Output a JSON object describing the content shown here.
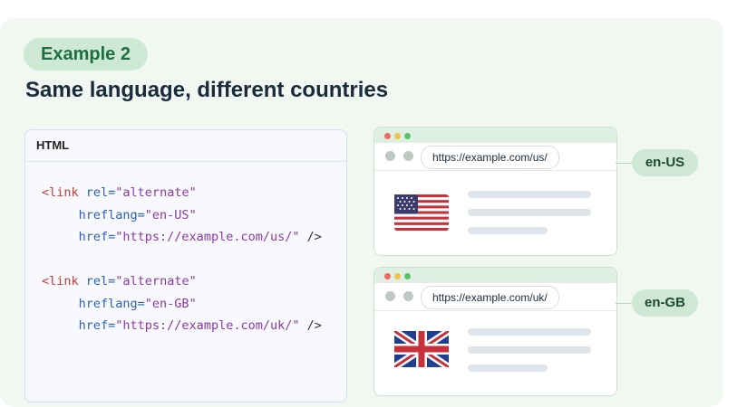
{
  "example_label": "Example 2",
  "title": "Same language, different countries",
  "code": {
    "header": "HTML",
    "block1": {
      "open": "<link",
      "rel_attr": "rel=",
      "rel_val": "\"alternate\"",
      "hreflang_attr": "hreflang=",
      "hreflang_val": "\"en-US\"",
      "href_attr": "href=",
      "href_val": "\"https://example.com/us/\"",
      "close": " />"
    },
    "block2": {
      "open": "<link",
      "rel_attr": "rel=",
      "rel_val": "\"alternate\"",
      "hreflang_attr": "hreflang=",
      "hreflang_val": "\"en-GB\"",
      "href_attr": "href=",
      "href_val": "\"https://example.com/uk/\"",
      "close": " />"
    }
  },
  "browsers": [
    {
      "url": "https://example.com/us/",
      "flag": "us-flag-icon",
      "locale": "en-US"
    },
    {
      "url": "https://example.com/uk/",
      "flag": "uk-flag-icon",
      "locale": "en-GB"
    }
  ],
  "colors": {
    "accent_green": "#1f6e43",
    "badge_bg": "#cde9d4",
    "tag": "#c43b3b",
    "attr": "#2f5fb0",
    "value": "#8a3aa7"
  }
}
